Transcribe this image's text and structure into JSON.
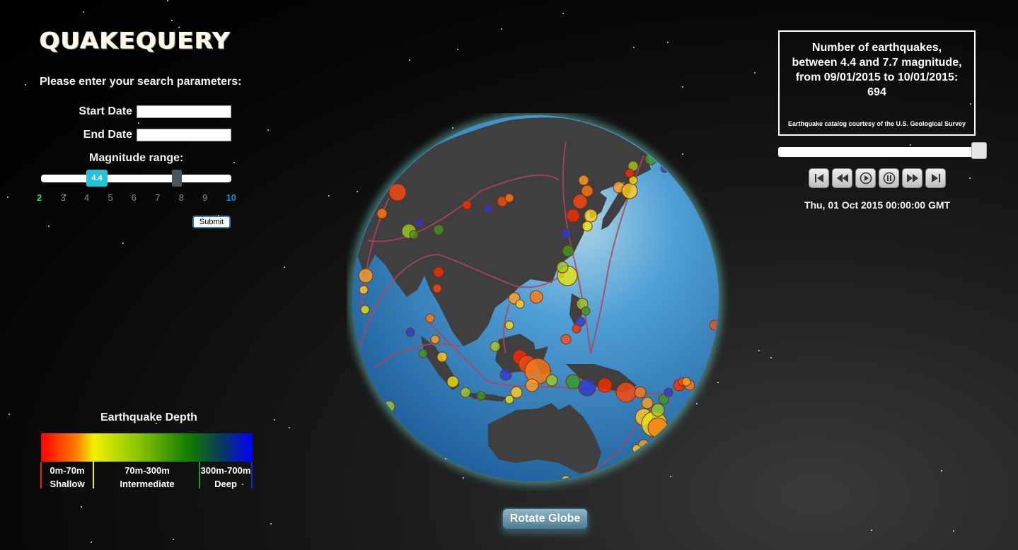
{
  "app": {
    "title": "QUAKEQUERY"
  },
  "search": {
    "prompt": "Please enter your search parameters:",
    "start_date_label": "Start Date",
    "start_date_value": "",
    "end_date_label": "End Date",
    "end_date_value": "",
    "magnitude_label": "Magnitude range:",
    "magnitude_low": "4.4",
    "magnitude_high": 7.7,
    "ticks": [
      "2",
      "3",
      "4",
      "5",
      "6",
      "7",
      "8",
      "9",
      "10"
    ],
    "submit_label": "Submit"
  },
  "legend": {
    "title": "Earthquake Depth",
    "bands": [
      {
        "range": "0m-70m",
        "name": "Shallow",
        "color": "#ff0000"
      },
      {
        "range": "70m-300m",
        "name": "Intermediate",
        "color": "#f0f000"
      },
      {
        "range": "300m-700m",
        "name": "Deep",
        "color": "#0000ff"
      }
    ]
  },
  "info": {
    "line1": "Number of earthquakes,",
    "line2": "between 4.4 and 7.7 magnitude,",
    "line3": "from 09/01/2015 to 10/01/2015:",
    "count": "694",
    "credit": "Earthquake catalog courtesy of the U.S. Geological Survey"
  },
  "timeline": {
    "progress": 1.0,
    "current_date": "Thu, 01 Oct 2015 00:00:00 GMT",
    "controls": [
      "skip-to-start-icon",
      "rewind-icon",
      "play-icon",
      "pause-icon",
      "fast-forward-icon",
      "skip-to-end-icon"
    ]
  },
  "globe": {
    "ocean_color": "#3a8ccf",
    "land_color": "#3d3d3d",
    "plate_boundary_color": "#b0455a"
  },
  "rotate_button_label": "Rotate Globe"
}
